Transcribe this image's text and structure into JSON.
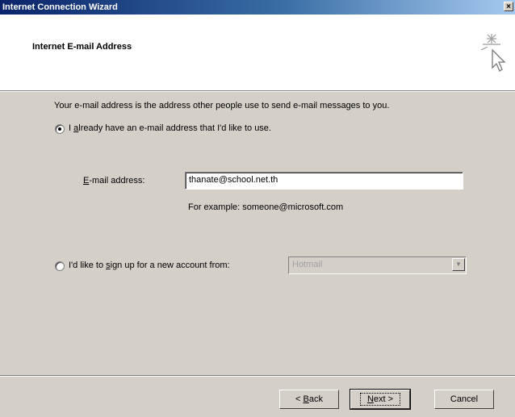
{
  "window": {
    "title": "Internet Connection Wizard",
    "close_glyph": "×"
  },
  "header": {
    "heading": "Internet E-mail Address",
    "icon": "wizard-wand-icon"
  },
  "body": {
    "description": "Your e-mail address is the address other people use to send e-mail messages to you.",
    "option_existing": {
      "label_pre": "I ",
      "label_accel": "a",
      "label_post": "lready have an e-mail address that I'd like to use.",
      "checked": true
    },
    "email_field": {
      "label_accel": "E",
      "label_post": "-mail address:",
      "value": "thanate@school.net.th"
    },
    "example_text": "For example: someone@microsoft.com",
    "option_new": {
      "label_pre": "I'd like to ",
      "label_accel": "s",
      "label_post": "ign up for a new account from:",
      "checked": false
    },
    "provider_select": {
      "value": "Hotmail",
      "enabled": false
    }
  },
  "buttons": {
    "back": {
      "pre": "< ",
      "accel": "B",
      "post": "ack"
    },
    "next": {
      "accel": "N",
      "post": "ext >"
    },
    "cancel": {
      "label": "Cancel"
    }
  }
}
